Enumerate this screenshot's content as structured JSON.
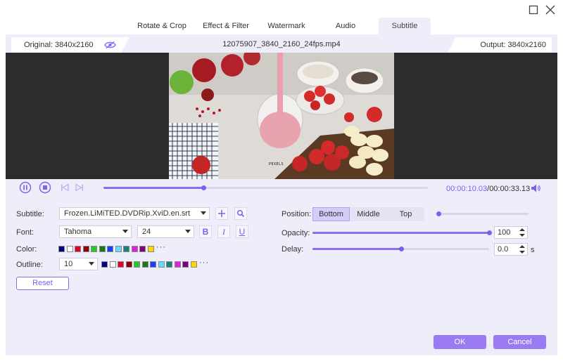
{
  "tabs": [
    {
      "label": "Rotate & Crop"
    },
    {
      "label": "Effect & Filter"
    },
    {
      "label": "Watermark"
    },
    {
      "label": "Audio"
    },
    {
      "label": "Subtitle"
    }
  ],
  "active_tab": "Subtitle",
  "preview": {
    "original_label": "Original: 3840x2160",
    "file_name": "12075907_3840_2160_24fps.mp4",
    "output_label": "Output: 3840x2160",
    "video_watermark": "PEXELS"
  },
  "playback": {
    "current_time": "00:00:10.03",
    "separator": "/",
    "total_time": "00:00:33.13",
    "progress": 0.307
  },
  "subtitle": {
    "label": "Subtitle:",
    "file": "Frozen.LiMiTED.DVDRip.XviD.en.srt"
  },
  "font": {
    "label": "Font:",
    "family": "Tahoma",
    "size": "24",
    "bold": "B",
    "italic": "I",
    "underline": "U"
  },
  "color": {
    "label": "Color:",
    "swatches": [
      "#000080",
      "#ffffff",
      "#e8002a",
      "#8b0000",
      "#22cc22",
      "#1a7a1a",
      "#1a40ff",
      "#66ddff",
      "#1a8080",
      "#e020e0",
      "#800080",
      "#ffd700"
    ],
    "more": "···"
  },
  "outline": {
    "label": "Outline:",
    "width": "10",
    "swatches": [
      "#000080",
      "#ffffff",
      "#e8002a",
      "#8b0000",
      "#22cc22",
      "#1a7a1a",
      "#1a40ff",
      "#66ddff",
      "#1a8080",
      "#e020e0",
      "#800080",
      "#ffd700"
    ],
    "more": "···"
  },
  "reset_label": "Reset",
  "position": {
    "label": "Position:",
    "options": [
      "Bottom",
      "Middle",
      "Top"
    ],
    "selected": "Bottom",
    "offset": 0.0
  },
  "opacity": {
    "label": "Opacity:",
    "value": "100",
    "level": 1.0
  },
  "delay": {
    "label": "Delay:",
    "value": "0.0",
    "unit": "s",
    "level": 0.5
  },
  "ok_label": "OK",
  "cancel_label": "Cancel",
  "colors": {
    "accent": "#8b6cf0",
    "panel_bg": "#eeeefa"
  }
}
